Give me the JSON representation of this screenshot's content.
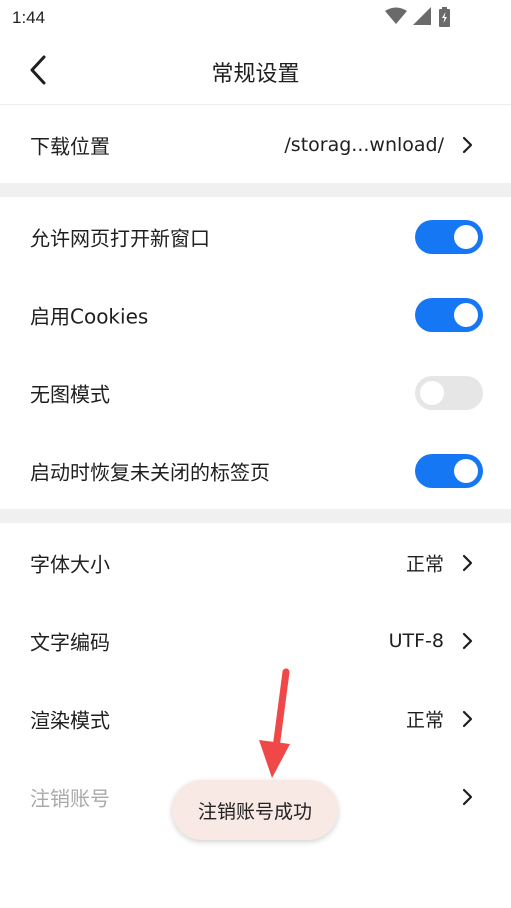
{
  "status_bar": {
    "time": "1:44"
  },
  "header": {
    "title": "常规设置"
  },
  "download": {
    "label": "下载位置",
    "value": "/storag...wnload/"
  },
  "toggles": [
    {
      "label": "允许网页打开新窗口",
      "on": true
    },
    {
      "label": "启用Cookies",
      "on": true
    },
    {
      "label": "无图模式",
      "on": false
    },
    {
      "label": "启动时恢复未关闭的标签页",
      "on": true
    }
  ],
  "settings": [
    {
      "label": "字体大小",
      "value": "正常"
    },
    {
      "label": "文字编码",
      "value": "UTF-8"
    },
    {
      "label": "渲染模式",
      "value": "正常"
    }
  ],
  "deactivate": {
    "label": "注销账号"
  },
  "toast": {
    "text": "注销账号成功"
  },
  "colors": {
    "accent": "#1677f4",
    "arrow": "#f04848",
    "toast_bg": "#f8e9e4"
  },
  "icons": {
    "back": "back-arrow-icon",
    "chevron": "chevron-right-icon",
    "wifi": "wifi-icon",
    "signal": "signal-icon",
    "battery": "battery-icon"
  }
}
